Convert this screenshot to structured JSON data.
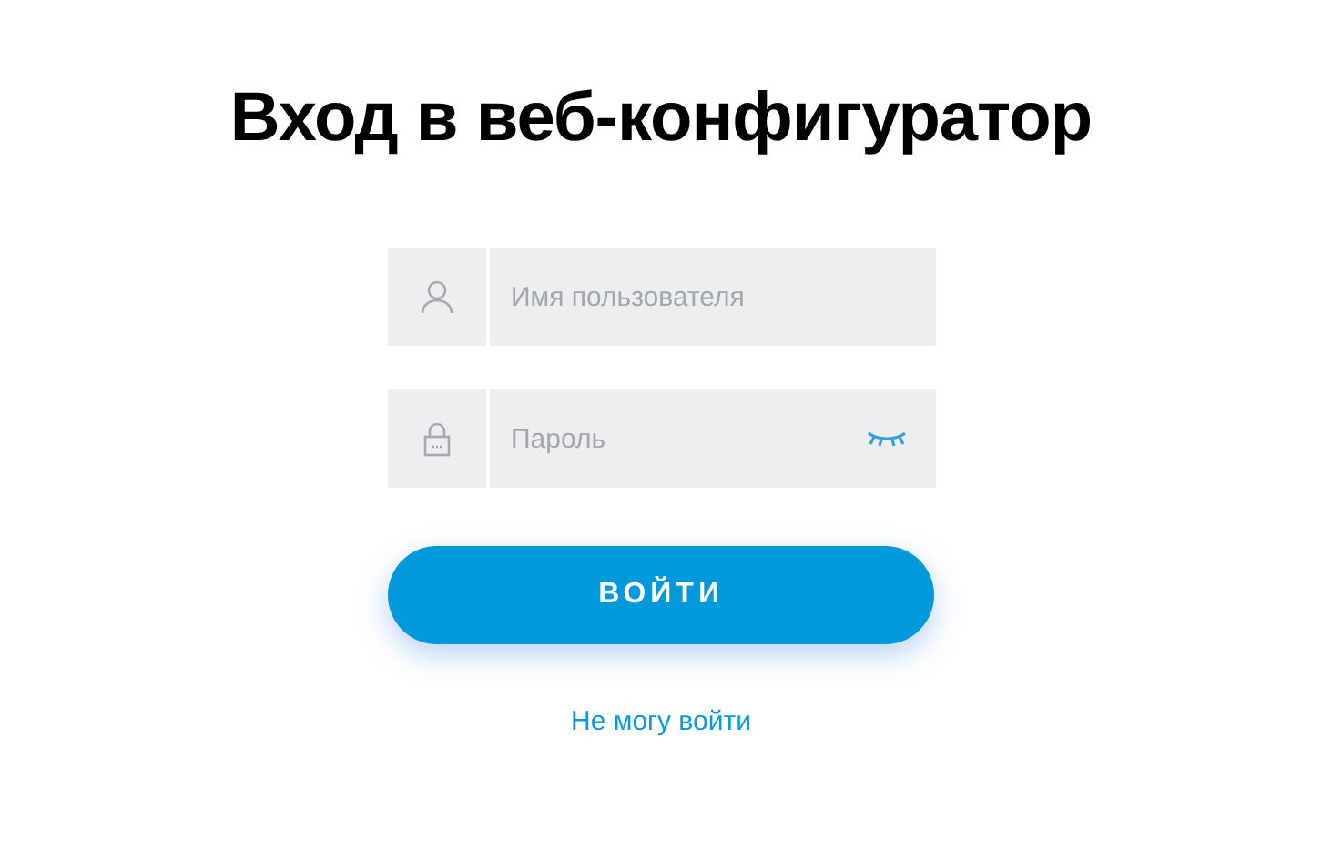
{
  "title": "Вход в веб-конфигуратор",
  "fields": [
    {
      "kind": "user",
      "placeholder": "Имя пользователя"
    },
    {
      "kind": "password",
      "placeholder": "Пароль"
    }
  ],
  "submit": "ВОЙТИ",
  "help_link": "Не могу войти"
}
